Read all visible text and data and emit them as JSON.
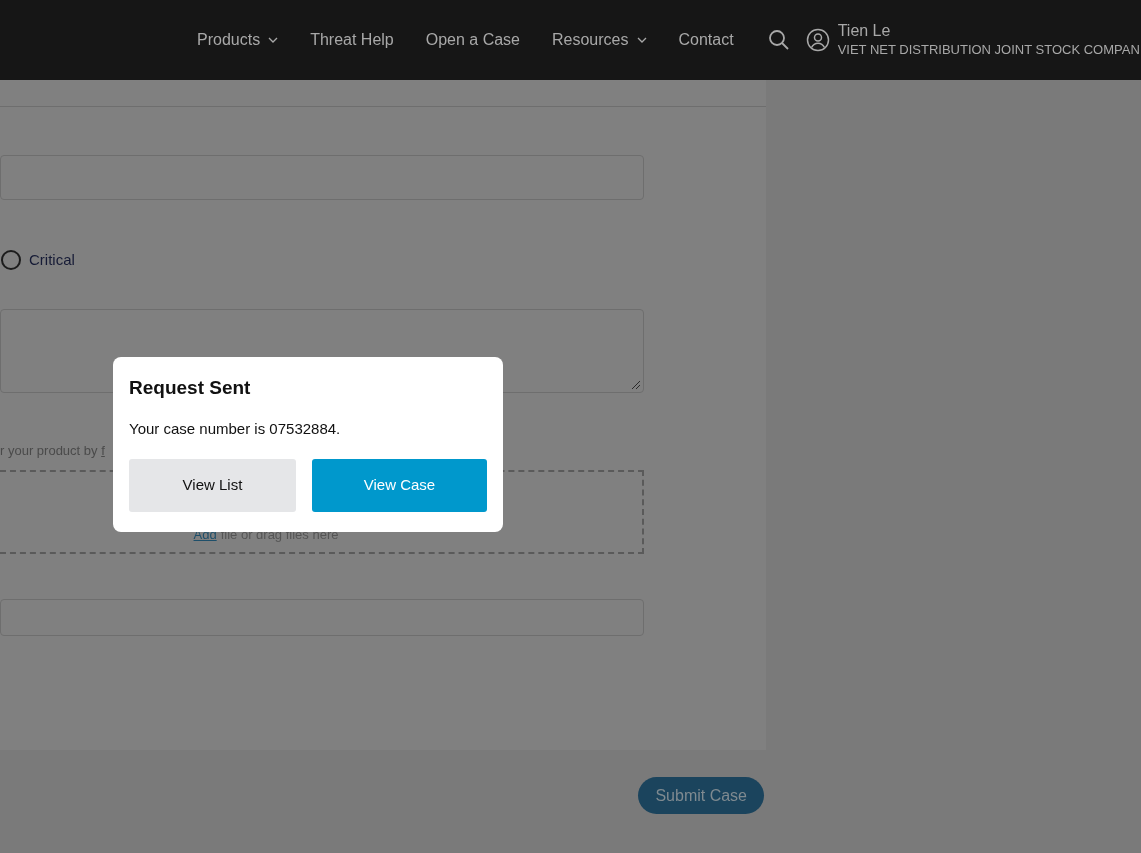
{
  "header": {
    "nav": [
      {
        "label": "Products",
        "has_menu": true
      },
      {
        "label": "Threat Help",
        "has_menu": false
      },
      {
        "label": "Open a Case",
        "has_menu": false
      },
      {
        "label": "Resources",
        "has_menu": true
      },
      {
        "label": "Contact",
        "has_menu": false
      }
    ],
    "user": {
      "name": "Tien Le",
      "company": "VIET NET DISTRIBUTION JOINT STOCK COMPAN"
    }
  },
  "form": {
    "severity_option": {
      "label": "Critical",
      "selected": false
    },
    "hint": {
      "text": "r your product by",
      "link": "f"
    },
    "dropzone": {
      "link": "Add",
      "text": "file or drag files here"
    },
    "submit": "Submit Case"
  },
  "dialog": {
    "title": "Request Sent",
    "message": "Your case number is 07532884.",
    "buttons": [
      {
        "label": "View List",
        "kind": "secondary"
      },
      {
        "label": "View Case",
        "kind": "primary"
      }
    ]
  }
}
